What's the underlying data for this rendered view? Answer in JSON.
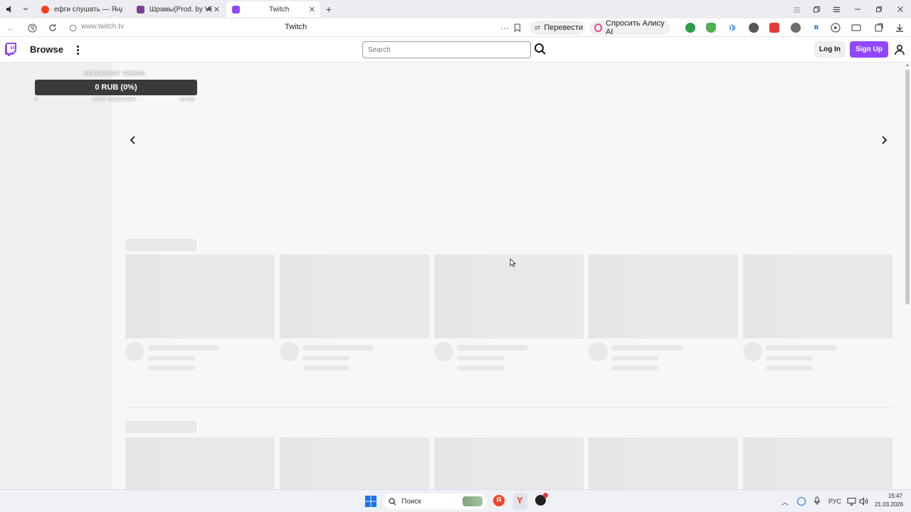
{
  "browser": {
    "tabs": [
      {
        "title": "ефги слушать — Яндекс:",
        "favicon": "yandex-icon",
        "color": "#fc3f1d"
      },
      {
        "title": "Шрамы(Prod. by VE",
        "favicon": "music-icon",
        "color": "#7b3f8f"
      },
      {
        "title": "Twitch",
        "favicon": "twitch-icon",
        "color": "#9147ff",
        "active": true
      }
    ],
    "url": "www.twitch.tv",
    "page_title": "Twitch",
    "translate_label": "Перевести",
    "alice_label": "Спросить Алису AI",
    "ext_b_label": "в"
  },
  "twitch": {
    "brand_color": "#9147ff",
    "browse_label": "Browse",
    "search_placeholder": "Search",
    "login_label": "Log In",
    "signup_label": "Sign Up"
  },
  "donation_widget": {
    "title": "NECESSARY THINGS",
    "amount": "0 RUB (0%)",
    "min_label": "0",
    "status_label": "СБОР ЗАВЕРШЕН",
    "max_label": "10 000",
    "progress": 0
  },
  "taskbar": {
    "search_label": "Поиск",
    "lang": "РУС",
    "time": "15:47",
    "date": "21.03.2026"
  }
}
